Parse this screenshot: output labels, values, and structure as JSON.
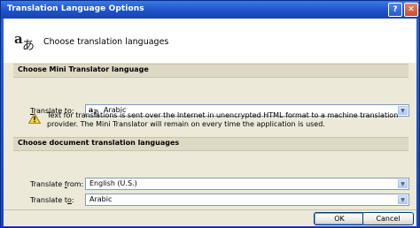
{
  "window": {
    "title": "Translation Language Options",
    "help_glyph": "?",
    "close_glyph": "✕"
  },
  "header": {
    "heading": "Choose translation languages",
    "icon": "translation-languages-icon"
  },
  "mini_translator": {
    "section_title": "Choose Mini Translator language",
    "translate_to": {
      "label_u": "T",
      "label_rest": "ranslate to:",
      "value": "Arabic"
    },
    "warning": "Text for translations is sent over the Internet in unencrypted HTML format to a machine translation provider. The Mini Translator will remain on every time the application is used."
  },
  "document_translation": {
    "section_title": "Choose document translation languages",
    "translate_from": {
      "label_pre": "Translate ",
      "label_u": "f",
      "label_rest": "rom:",
      "value": "English (U.S.)"
    },
    "translate_to": {
      "label_pre": "Translate t",
      "label_u": "o",
      "label_rest": ":",
      "value": "Arabic"
    }
  },
  "footer": {
    "ok_label": "OK",
    "cancel_label": "Cancel"
  },
  "colors": {
    "titlebar": "#1f52c9",
    "client": "#ece9d8",
    "section": "#ddd9c5",
    "dropdown_border": "#7f9db9"
  }
}
